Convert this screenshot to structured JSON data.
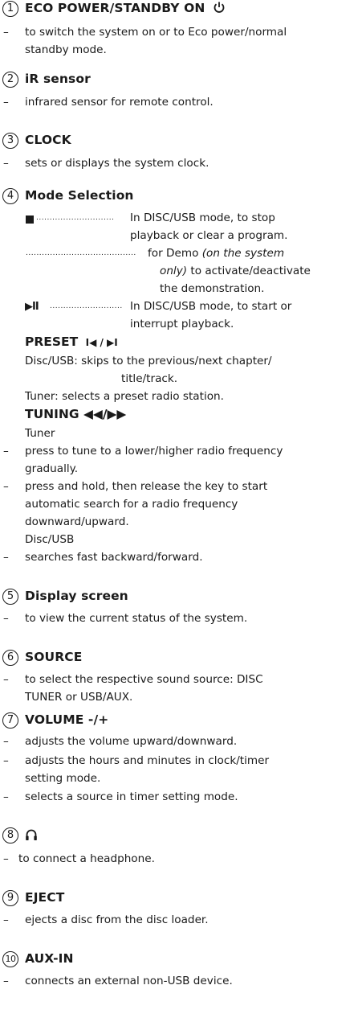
{
  "s1": {
    "num": "1",
    "title": "ECO POWER/STANDBY ON",
    "power_icon": "power-icon",
    "l1": "to switch the system on or to Eco power/normal",
    "l2": "standby mode."
  },
  "s2": {
    "num": "2",
    "title": "iR sensor",
    "l1": "infrared sensor for remote control."
  },
  "s3": {
    "num": "3",
    "title": "CLOCK",
    "l1": "sets or displays the system clock."
  },
  "s4": {
    "num": "4",
    "title": "Mode Selection",
    "stop_dots": ".............................",
    "stop_l1": "In DISC/USB mode, to stop",
    "stop_l2": "playback or clear a program.",
    "demo_dots": ".........................................",
    "demo_l1_a": "for Demo ",
    "demo_l1_b": "(on the system",
    "demo_l2_a": "only)",
    "demo_l2_b": " to activate/deactivate",
    "demo_l3": "the demonstration.",
    "play_sym": "▶II",
    "play_dots": "...........................",
    "play_l1": "In DISC/USB mode, to start or",
    "play_l2": "interrupt playback.",
    "preset_title": "PRESET",
    "preset_syms": "I◀ / ▶I",
    "preset_l1": "Disc/USB: skips to the previous/next chapter/",
    "preset_l2": "title/track.",
    "preset_l3": "Tuner: selects a preset radio station.",
    "tuning_title": "TUNING ◀◀/▶▶",
    "tuner": "Tuner",
    "t_l1": "press to tune to a lower/higher radio frequency",
    "t_l2": "gradually.",
    "t_l3": "press and hold, then release the key to start",
    "t_l4": "automatic search for a radio frequency",
    "t_l5": "downward/upward.",
    "discusb": "Disc/USB",
    "t_l6": "searches fast backward/forward."
  },
  "s5": {
    "num": "5",
    "title": "Display screen",
    "l1": "to view the current status of the system."
  },
  "s6": {
    "num": "6",
    "title": "SOURCE",
    "l1": "to select the respective sound source: DISC",
    "l2": "TUNER or USB/AUX."
  },
  "s7": {
    "num": "7",
    "title": "VOLUME -/+",
    "l1": "adjusts the volume upward/downward.",
    "l2": "adjusts the hours and minutes in clock/timer",
    "l3": "setting mode.",
    "l4": "selects a source in timer setting mode."
  },
  "s8": {
    "num": "8",
    "icon": "headphone-icon",
    "l1": "to connect a headphone."
  },
  "s9": {
    "num": "9",
    "title": "EJECT",
    "l1": "ejects a disc from the disc loader."
  },
  "s10": {
    "num": "10",
    "title": "AUX-IN",
    "l1": "connects an external non-USB device."
  },
  "dash": "–"
}
